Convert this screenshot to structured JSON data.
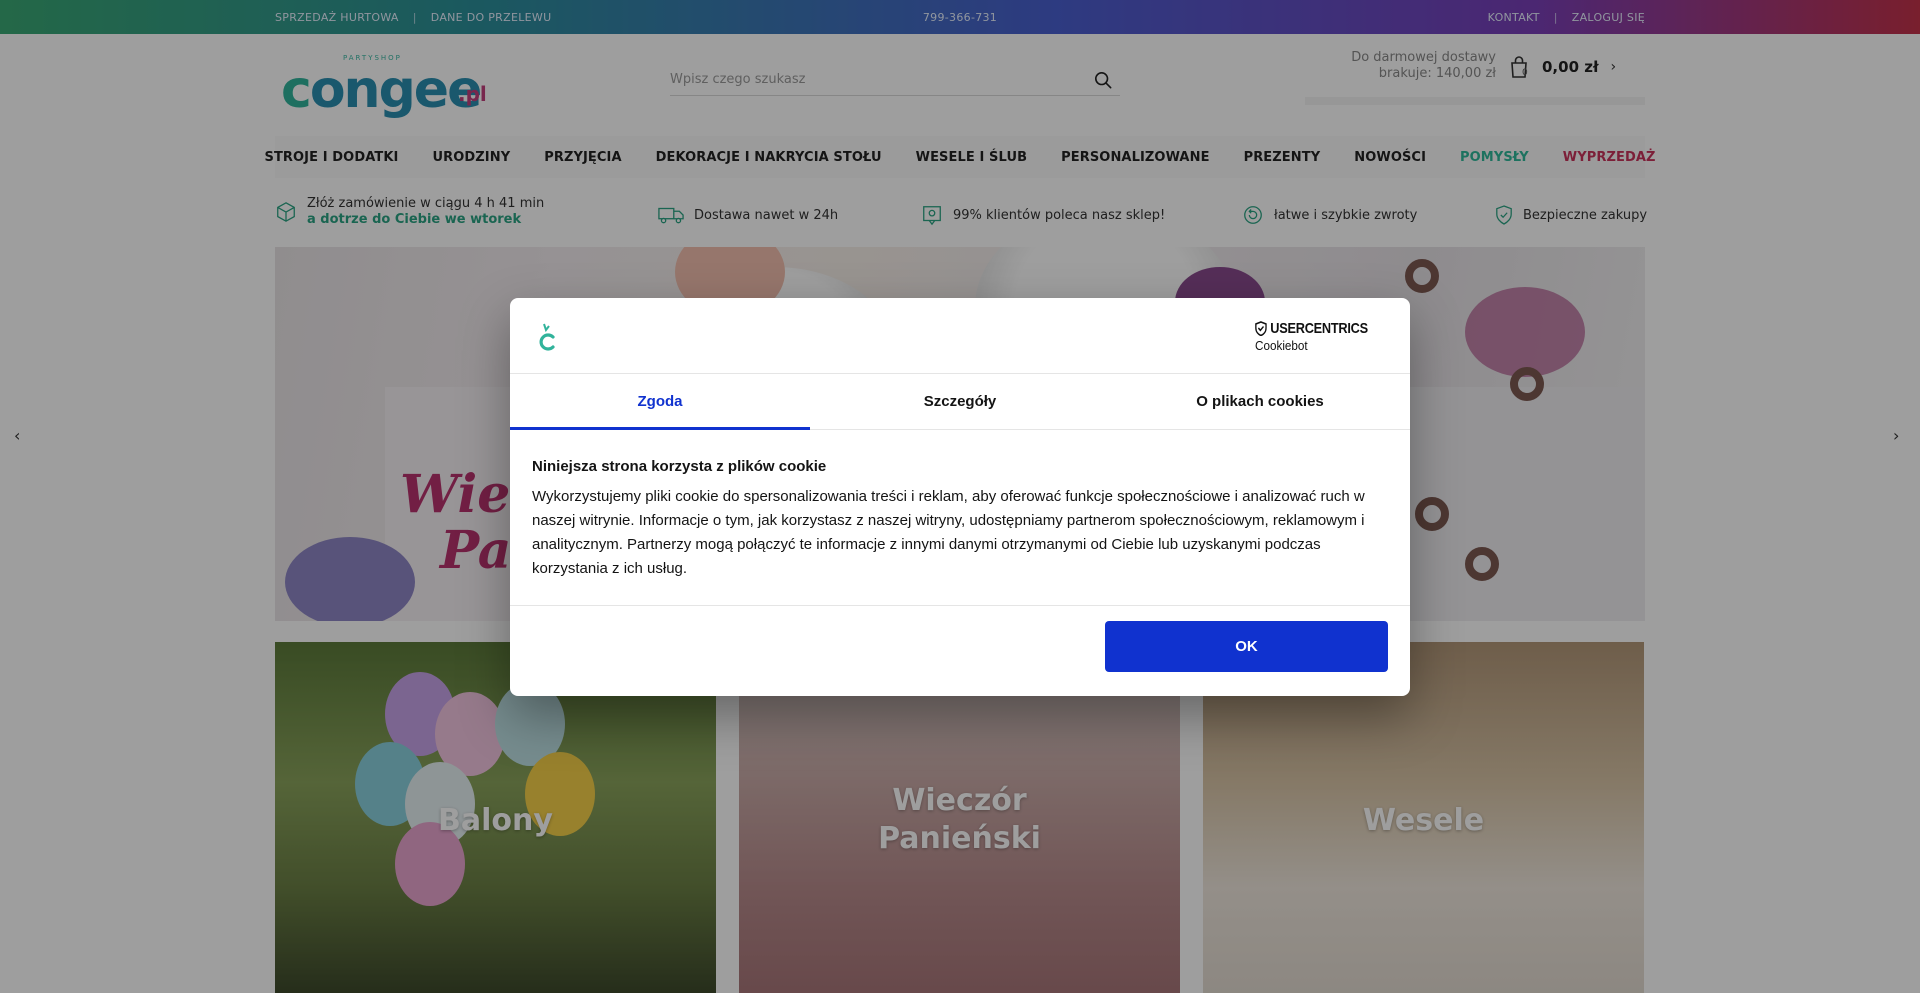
{
  "topbar": {
    "wholesale": "SPRZEDAŻ HURTOWA",
    "transfer": "DANE DO PRZELEWU",
    "phone": "799-366-731",
    "contact": "KONTAKT",
    "login": "ZALOGUJ SIĘ"
  },
  "header": {
    "logo_sub": "PARTYSHOP",
    "logo_word_c": "c",
    "logo_word_rest": "ongee",
    "logo_pl": ".pl",
    "search_placeholder": "Wpisz czego szukasz",
    "delivery_line1": "Do darmowej dostawy",
    "delivery_line2": "brakuje: 140,00 zł",
    "cart_count": "0",
    "cart_amount": "0,00 zł"
  },
  "nav": [
    {
      "label": "STROJE I DODATKI",
      "style": ""
    },
    {
      "label": "URODZINY",
      "style": ""
    },
    {
      "label": "PRZYJĘCIA",
      "style": ""
    },
    {
      "label": "DEKORACJE I NAKRYCIA STOŁU",
      "style": ""
    },
    {
      "label": "WESELE I ŚLUB",
      "style": ""
    },
    {
      "label": "PERSONALIZOWANE",
      "style": ""
    },
    {
      "label": "PREZENTY",
      "style": ""
    },
    {
      "label": "NOWOŚCI",
      "style": ""
    },
    {
      "label": "POMYSŁY",
      "style": "green"
    },
    {
      "label": "WYPRZEDAŻ",
      "style": "red"
    }
  ],
  "features": {
    "order_line1": "Złóż zamówienie w ciągu 4 h 41 min",
    "order_line2": "a dotrze do Ciebie we wtorek",
    "delivery": "Dostawa nawet w 24h",
    "recommend": "99% klientów poleca nasz sklep!",
    "returns": "łatwe i szybkie zwroty",
    "secure": "Bezpieczne zakupy"
  },
  "hero": {
    "script_line1": "Wiec",
    "script_line2": "Pa"
  },
  "tiles": [
    {
      "title": "Balony"
    },
    {
      "title_line1": "Wieczór",
      "title_line2": "Panieński"
    },
    {
      "title": "Wesele"
    }
  ],
  "cookie": {
    "brand_line1": "USERCENTRICS",
    "brand_line2": "Cookiebot",
    "tabs": [
      "Zgoda",
      "Szczegóły",
      "O plikach cookies"
    ],
    "heading": "Niniejsza strona korzysta z plików cookie",
    "body": "Wykorzystujemy pliki cookie do spersonalizowania treści i reklam, aby oferować funkcje społecznościowe i analizować ruch w naszej witrynie. Informacje o tym, jak korzystasz z naszej witryny, udostępniamy partnerom społecznościowym, reklamowym i analitycznym. Partnerzy mogą połączyć te informacje z innymi danymi otrzymanymi od Ciebie lub uzyskanymi podczas korzystania z ich usług.",
    "ok_label": "OK"
  },
  "colors": {
    "accent_blue": "#1032cf",
    "brand_green": "#2fb89a",
    "brand_red": "#c8325b"
  }
}
